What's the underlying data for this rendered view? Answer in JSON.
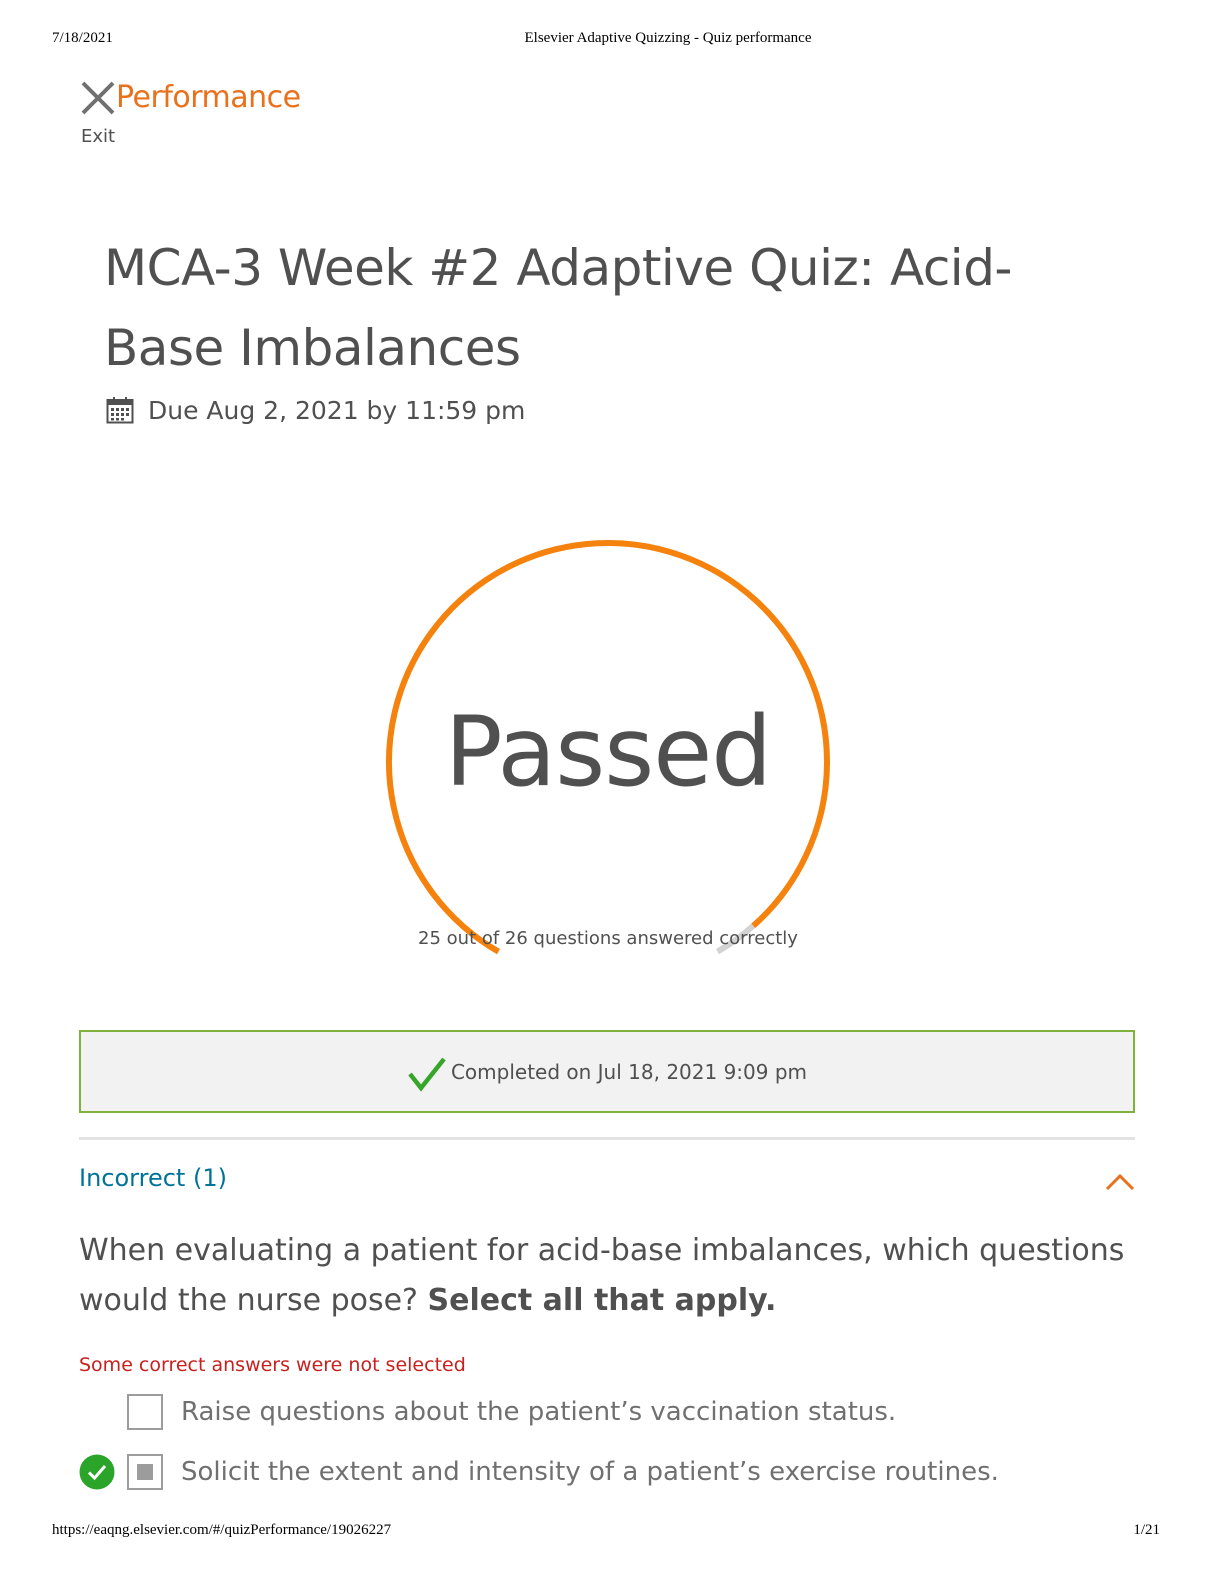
{
  "print_header": {
    "date": "7/18/2021",
    "title": "Elsevier Adaptive Quizzing - Quiz performance"
  },
  "print_footer": {
    "url": "https://eaqng.elsevier.com/#/quizPerformance/19026227",
    "page": "1/21"
  },
  "header": {
    "title": "Performance",
    "exit_label": "Exit",
    "exit_icon": "close-x-icon"
  },
  "quiz": {
    "title": "MCA-3 Week #2 Adaptive Quiz: Acid-Base Imbalances",
    "due": "Due Aug 2, 2021 by 11:59 pm",
    "due_icon": "calendar-icon"
  },
  "result": {
    "status": "Passed",
    "correct": 25,
    "total": 26,
    "score_text": "25 out of 26 questions answered correctly",
    "colors": {
      "correct": "#f5820d",
      "incorrect": "#d3d3d3"
    }
  },
  "completed": {
    "text": "Completed on Jul 18, 2021 9:09 pm",
    "icon": "check-icon",
    "colors": {
      "border": "#7fb13b",
      "check": "#36a52a"
    }
  },
  "section": {
    "title": "Incorrect (1)",
    "toggle_icon": "chevron-up-icon"
  },
  "question": {
    "text": "When evaluating a patient for acid-base imbalances, which questions would the nurse pose?",
    "instruction": "Select all that apply.",
    "feedback": "Some correct answers were not selected",
    "answers": [
      {
        "text": "Raise questions about the patient’s vaccination status.",
        "selected": false,
        "marked_correct": false
      },
      {
        "text": "Solicit the extent and intensity of a patient’s exercise routines.",
        "selected": true,
        "marked_correct": true
      }
    ]
  }
}
